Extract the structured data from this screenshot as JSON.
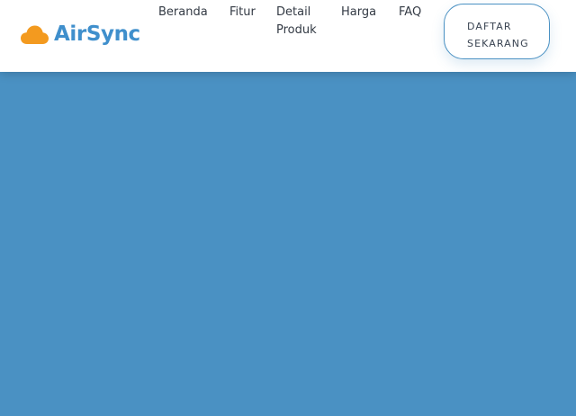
{
  "brand": {
    "name": "AirSync",
    "icon": "cloud-icon",
    "icon_color": "#f39a1f",
    "text_color": "#3f8fcc"
  },
  "nav": {
    "items": [
      {
        "label": "Beranda"
      },
      {
        "label": "Fitur"
      },
      {
        "label": "Detail Produk"
      },
      {
        "label": "Harga"
      },
      {
        "label": "FAQ"
      }
    ],
    "cta_label": "DAFTAR SEKARANG"
  },
  "theme": {
    "hero_background": "#4a91c3",
    "navbar_background": "#ffffff"
  }
}
